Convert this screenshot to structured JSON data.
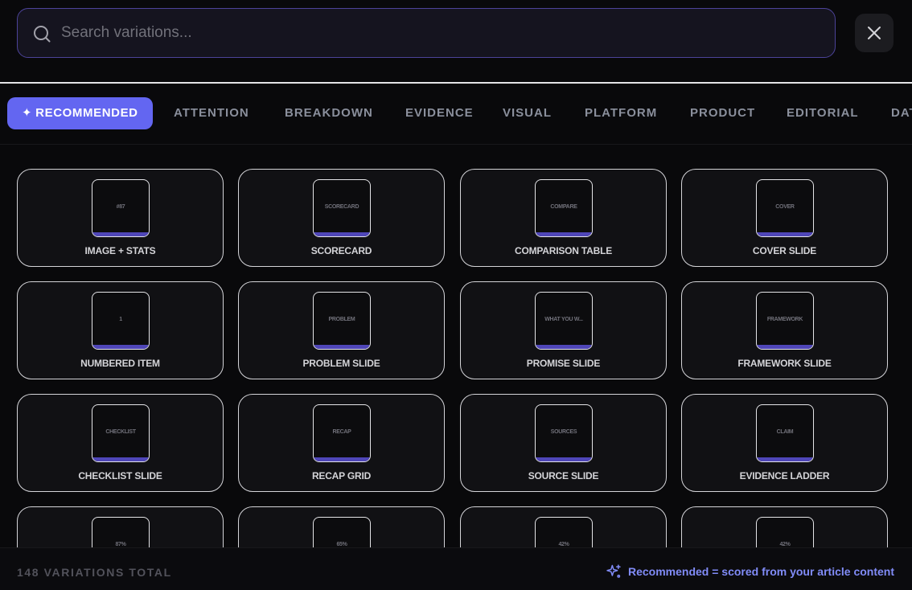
{
  "search": {
    "placeholder": "Search variations..."
  },
  "close": {
    "icon": "close-icon"
  },
  "tabs": [
    {
      "label": "RECOMMENDED",
      "icon": "✦",
      "active": true
    },
    {
      "label": "ATTENTION"
    },
    {
      "label": "BREAKDOWN"
    },
    {
      "label": "EVIDENCE"
    },
    {
      "label": "VISUAL"
    },
    {
      "label": "PLATFORM"
    },
    {
      "label": "PRODUCT"
    },
    {
      "label": "EDITORIAL"
    },
    {
      "label": "DAT"
    }
  ],
  "cards": [
    {
      "thumb": "#87",
      "label": "IMAGE + STATS"
    },
    {
      "thumb": "SCORECARD",
      "label": "SCORECARD"
    },
    {
      "thumb": "COMPARE",
      "label": "COMPARISON TABLE"
    },
    {
      "thumb": "COVER",
      "label": "COVER SLIDE"
    },
    {
      "thumb": "1",
      "label": "NUMBERED ITEM"
    },
    {
      "thumb": "PROBLEM",
      "label": "PROBLEM SLIDE"
    },
    {
      "thumb": "WHAT YOU W...",
      "label": "PROMISE SLIDE"
    },
    {
      "thumb": "FRAMEWORK",
      "label": "FRAMEWORK SLIDE"
    },
    {
      "thumb": "CHECKLIST",
      "label": "CHECKLIST SLIDE"
    },
    {
      "thumb": "RECAP",
      "label": "RECAP GRID"
    },
    {
      "thumb": "SOURCES",
      "label": "SOURCE SLIDE"
    },
    {
      "thumb": "CLAIM",
      "label": "EVIDENCE LADDER"
    },
    {
      "thumb": "87%",
      "label": ""
    },
    {
      "thumb": "65%",
      "label": ""
    },
    {
      "thumb": "42%",
      "label": ""
    },
    {
      "thumb": "42%",
      "label": ""
    }
  ],
  "footer": {
    "total": "148 VARIATIONS TOTAL",
    "note": "Recommended = scored from your article content",
    "note_icon": "sparkle-icon"
  },
  "colors": {
    "accent": "#6366f1",
    "background": "#09090b",
    "card": "#111114",
    "note": "#818cf8"
  }
}
